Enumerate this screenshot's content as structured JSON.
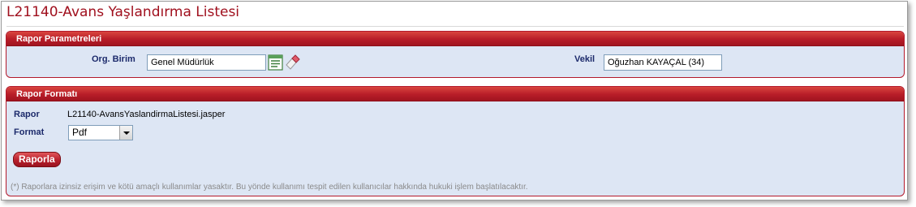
{
  "page": {
    "title": "L21140-Avans Yaşlandırma Listesi"
  },
  "params": {
    "header": "Rapor Parametreleri",
    "org_label": "Org. Birim",
    "org_value": "Genel Müdürlük",
    "lookup_icon": "list-lookup-icon",
    "clear_icon": "eraser-icon",
    "vekil_label": "Vekil",
    "vekil_value": "Oğuzhan KAYAÇAL (34)"
  },
  "format": {
    "header": "Rapor Formatı",
    "rapor_label": "Rapor",
    "rapor_value": "L21140-AvansYaslandirmaListesi.jasper",
    "format_label": "Format",
    "format_value": "Pdf",
    "button_label": "Raporla",
    "note": "(*) Raporlara izinsiz erişim ve kötü amaçlı kullanımlar yasaktır. Bu yönde kullanımı tespit edilen kullanıcılar hakkında hukuki işlem başlatılacaktır."
  },
  "colors": {
    "accent": "#b81d28",
    "panel_bg": "#dde6f4",
    "label": "#1c2a6b",
    "title": "#a0101e"
  }
}
